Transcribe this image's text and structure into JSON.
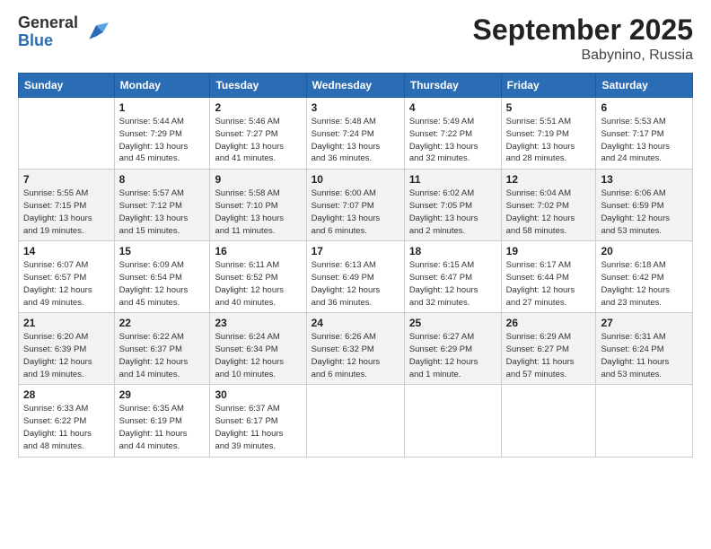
{
  "logo": {
    "general": "General",
    "blue": "Blue"
  },
  "header": {
    "month": "September 2025",
    "location": "Babynino, Russia"
  },
  "weekdays": [
    "Sunday",
    "Monday",
    "Tuesday",
    "Wednesday",
    "Thursday",
    "Friday",
    "Saturday"
  ],
  "weeks": [
    [
      {
        "day": "",
        "info": ""
      },
      {
        "day": "1",
        "info": "Sunrise: 5:44 AM\nSunset: 7:29 PM\nDaylight: 13 hours\nand 45 minutes."
      },
      {
        "day": "2",
        "info": "Sunrise: 5:46 AM\nSunset: 7:27 PM\nDaylight: 13 hours\nand 41 minutes."
      },
      {
        "day": "3",
        "info": "Sunrise: 5:48 AM\nSunset: 7:24 PM\nDaylight: 13 hours\nand 36 minutes."
      },
      {
        "day": "4",
        "info": "Sunrise: 5:49 AM\nSunset: 7:22 PM\nDaylight: 13 hours\nand 32 minutes."
      },
      {
        "day": "5",
        "info": "Sunrise: 5:51 AM\nSunset: 7:19 PM\nDaylight: 13 hours\nand 28 minutes."
      },
      {
        "day": "6",
        "info": "Sunrise: 5:53 AM\nSunset: 7:17 PM\nDaylight: 13 hours\nand 24 minutes."
      }
    ],
    [
      {
        "day": "7",
        "info": "Sunrise: 5:55 AM\nSunset: 7:15 PM\nDaylight: 13 hours\nand 19 minutes."
      },
      {
        "day": "8",
        "info": "Sunrise: 5:57 AM\nSunset: 7:12 PM\nDaylight: 13 hours\nand 15 minutes."
      },
      {
        "day": "9",
        "info": "Sunrise: 5:58 AM\nSunset: 7:10 PM\nDaylight: 13 hours\nand 11 minutes."
      },
      {
        "day": "10",
        "info": "Sunrise: 6:00 AM\nSunset: 7:07 PM\nDaylight: 13 hours\nand 6 minutes."
      },
      {
        "day": "11",
        "info": "Sunrise: 6:02 AM\nSunset: 7:05 PM\nDaylight: 13 hours\nand 2 minutes."
      },
      {
        "day": "12",
        "info": "Sunrise: 6:04 AM\nSunset: 7:02 PM\nDaylight: 12 hours\nand 58 minutes."
      },
      {
        "day": "13",
        "info": "Sunrise: 6:06 AM\nSunset: 6:59 PM\nDaylight: 12 hours\nand 53 minutes."
      }
    ],
    [
      {
        "day": "14",
        "info": "Sunrise: 6:07 AM\nSunset: 6:57 PM\nDaylight: 12 hours\nand 49 minutes."
      },
      {
        "day": "15",
        "info": "Sunrise: 6:09 AM\nSunset: 6:54 PM\nDaylight: 12 hours\nand 45 minutes."
      },
      {
        "day": "16",
        "info": "Sunrise: 6:11 AM\nSunset: 6:52 PM\nDaylight: 12 hours\nand 40 minutes."
      },
      {
        "day": "17",
        "info": "Sunrise: 6:13 AM\nSunset: 6:49 PM\nDaylight: 12 hours\nand 36 minutes."
      },
      {
        "day": "18",
        "info": "Sunrise: 6:15 AM\nSunset: 6:47 PM\nDaylight: 12 hours\nand 32 minutes."
      },
      {
        "day": "19",
        "info": "Sunrise: 6:17 AM\nSunset: 6:44 PM\nDaylight: 12 hours\nand 27 minutes."
      },
      {
        "day": "20",
        "info": "Sunrise: 6:18 AM\nSunset: 6:42 PM\nDaylight: 12 hours\nand 23 minutes."
      }
    ],
    [
      {
        "day": "21",
        "info": "Sunrise: 6:20 AM\nSunset: 6:39 PM\nDaylight: 12 hours\nand 19 minutes."
      },
      {
        "day": "22",
        "info": "Sunrise: 6:22 AM\nSunset: 6:37 PM\nDaylight: 12 hours\nand 14 minutes."
      },
      {
        "day": "23",
        "info": "Sunrise: 6:24 AM\nSunset: 6:34 PM\nDaylight: 12 hours\nand 10 minutes."
      },
      {
        "day": "24",
        "info": "Sunrise: 6:26 AM\nSunset: 6:32 PM\nDaylight: 12 hours\nand 6 minutes."
      },
      {
        "day": "25",
        "info": "Sunrise: 6:27 AM\nSunset: 6:29 PM\nDaylight: 12 hours\nand 1 minute."
      },
      {
        "day": "26",
        "info": "Sunrise: 6:29 AM\nSunset: 6:27 PM\nDaylight: 11 hours\nand 57 minutes."
      },
      {
        "day": "27",
        "info": "Sunrise: 6:31 AM\nSunset: 6:24 PM\nDaylight: 11 hours\nand 53 minutes."
      }
    ],
    [
      {
        "day": "28",
        "info": "Sunrise: 6:33 AM\nSunset: 6:22 PM\nDaylight: 11 hours\nand 48 minutes."
      },
      {
        "day": "29",
        "info": "Sunrise: 6:35 AM\nSunset: 6:19 PM\nDaylight: 11 hours\nand 44 minutes."
      },
      {
        "day": "30",
        "info": "Sunrise: 6:37 AM\nSunset: 6:17 PM\nDaylight: 11 hours\nand 39 minutes."
      },
      {
        "day": "",
        "info": ""
      },
      {
        "day": "",
        "info": ""
      },
      {
        "day": "",
        "info": ""
      },
      {
        "day": "",
        "info": ""
      }
    ]
  ]
}
